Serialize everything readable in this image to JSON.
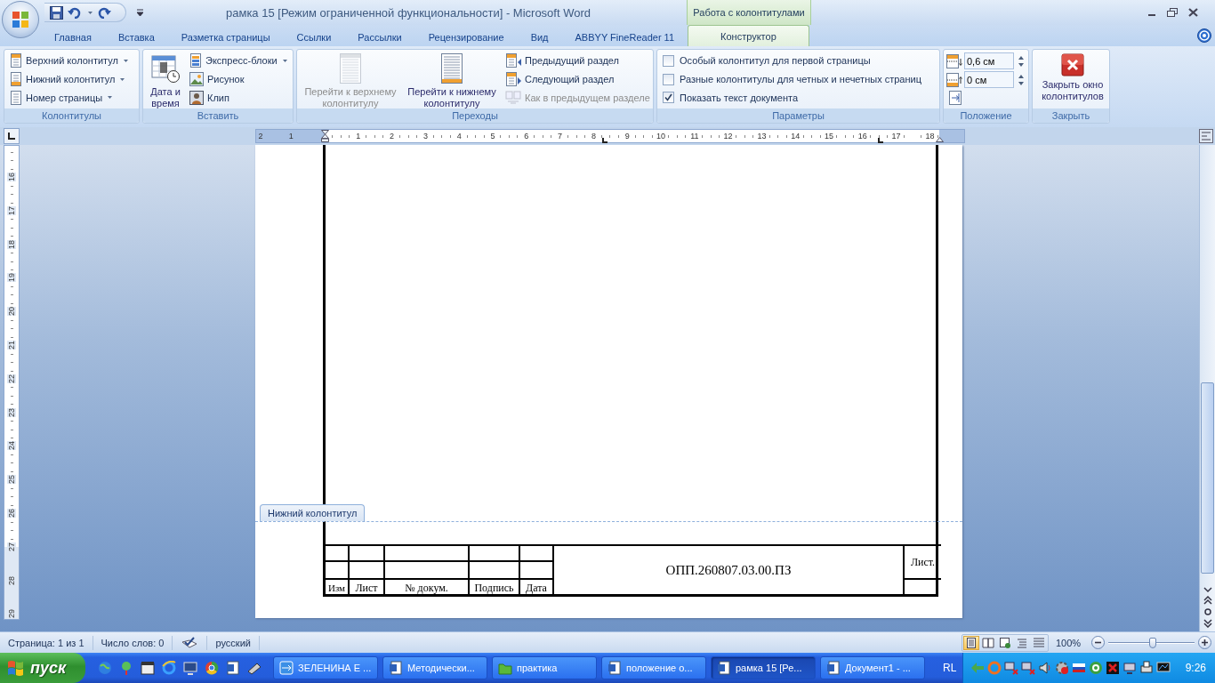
{
  "window": {
    "title": "рамка 15 [Режим ограниченной функциональности] - Microsoft Word",
    "context_title": "Работа с колонтитулами"
  },
  "tabs": [
    {
      "label": "Главная",
      "selected": false
    },
    {
      "label": "Вставка",
      "selected": false
    },
    {
      "label": "Разметка страницы",
      "selected": false
    },
    {
      "label": "Ссылки",
      "selected": false
    },
    {
      "label": "Рассылки",
      "selected": false
    },
    {
      "label": "Рецензирование",
      "selected": false
    },
    {
      "label": "Вид",
      "selected": false
    },
    {
      "label": "ABBYY FineReader 11",
      "selected": false
    },
    {
      "label": "Конструктор",
      "selected": true
    }
  ],
  "ribbon": {
    "groups": [
      {
        "title": "Колонтитулы",
        "items": [
          {
            "kind": "small",
            "label": "Верхний колонтитул",
            "dropdown": true,
            "disabled": false
          },
          {
            "kind": "small",
            "label": "Нижний колонтитул",
            "dropdown": true,
            "disabled": false
          },
          {
            "kind": "small",
            "label": "Номер страницы",
            "dropdown": true,
            "disabled": false
          }
        ]
      },
      {
        "title": "Вставить",
        "items": [
          {
            "kind": "large",
            "label": "Дата и время",
            "disabled": false
          },
          {
            "kind": "small",
            "label": "Экспресс-блоки",
            "dropdown": true,
            "disabled": false
          },
          {
            "kind": "small",
            "label": "Рисунок",
            "dropdown": false,
            "disabled": false
          },
          {
            "kind": "small",
            "label": "Клип",
            "dropdown": false,
            "disabled": false
          }
        ]
      },
      {
        "title": "Переходы",
        "items": [
          {
            "kind": "large",
            "label": "Перейти к верхнему колонтитулу",
            "disabled": true
          },
          {
            "kind": "large",
            "label": "Перейти к нижнему колонтитулу",
            "disabled": false
          },
          {
            "kind": "small",
            "label": "Предыдущий раздел",
            "dropdown": false,
            "disabled": false
          },
          {
            "kind": "small",
            "label": "Следующий раздел",
            "dropdown": false,
            "disabled": false
          },
          {
            "kind": "small",
            "label": "Как в предыдущем разделе",
            "dropdown": false,
            "disabled": true
          }
        ]
      },
      {
        "title": "Параметры",
        "items": [
          {
            "kind": "checkbox",
            "label": "Особый колонтитул для первой страницы",
            "checked": false
          },
          {
            "kind": "checkbox",
            "label": "Разные колонтитулы для четных и нечетных страниц",
            "checked": false
          },
          {
            "kind": "checkbox",
            "label": "Показать текст документа",
            "checked": true
          }
        ]
      },
      {
        "title": "Положение",
        "items": [
          {
            "kind": "spin",
            "value": "0,6 см"
          },
          {
            "kind": "spin",
            "value": "0 см"
          },
          {
            "kind": "icon"
          }
        ]
      },
      {
        "title": "Закрыть",
        "items": [
          {
            "kind": "large",
            "label": "Закрыть окно колонтитулов",
            "disabled": false
          }
        ]
      }
    ]
  },
  "horizontal_ruler": {
    "labels": [
      "2",
      "1",
      "1",
      "2",
      "3",
      "4",
      "5",
      "6",
      "7",
      "8",
      "9",
      "10",
      "11",
      "12",
      "13",
      "14",
      "15",
      "16",
      "17",
      "18"
    ]
  },
  "vertical_ruler": {
    "labels": [
      "16",
      "17",
      "18",
      "19",
      "20",
      "21",
      "22",
      "23",
      "24",
      "25",
      "26",
      "27",
      "28",
      "29"
    ]
  },
  "document": {
    "footer_tag": "Нижний колонтитул",
    "stamp": {
      "headers": [
        "Изм",
        "Лист",
        "№ докум.",
        "Подпись",
        "Дата"
      ],
      "designation": "ОПП.260807.03.00.ПЗ",
      "sheet_label": "Лист."
    }
  },
  "status_bar": {
    "page": "Страница: 1 из 1",
    "words": "Число слов: 0",
    "language": "русский",
    "views": [
      {
        "selected": true
      },
      {
        "selected": false
      },
      {
        "selected": false
      },
      {
        "selected": false
      },
      {
        "selected": false
      }
    ],
    "zoom": {
      "label": "100%",
      "level": 0.52
    }
  },
  "taskbar": {
    "start": "пуск",
    "tasks": [
      {
        "kind": "drive",
        "label": "ЗЕЛЕНИНА Е ...",
        "selected": false
      },
      {
        "kind": "document",
        "label": "Методически...",
        "selected": false
      },
      {
        "kind": "folder",
        "label": "практика",
        "selected": false
      },
      {
        "kind": "document",
        "label": "положение о...",
        "selected": false
      },
      {
        "kind": "document",
        "label": "рамка 15 [Ре...",
        "selected": true
      },
      {
        "kind": "document",
        "label": "Документ1 - ...",
        "selected": false
      }
    ],
    "language": "RL",
    "clock": "9:26"
  }
}
